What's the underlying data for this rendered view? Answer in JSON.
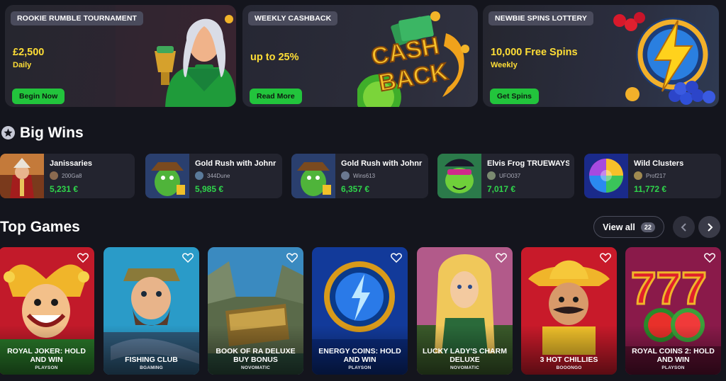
{
  "promos": [
    {
      "tag": "ROOKIE RUMBLE TOURNAMENT",
      "amount": "£2,500",
      "sub": "Daily",
      "button": "Begin Now"
    },
    {
      "tag": "WEEKLY CASHBACK",
      "amount": "up to 25%",
      "sub": "",
      "button": "Read More",
      "art_text_1": "CASH",
      "art_text_2": "BACK"
    },
    {
      "tag": "NEWBIE SPINS LOTTERY",
      "amount": "10,000 Free Spins",
      "sub": "Weekly",
      "button": "Get Spins"
    }
  ],
  "big_wins": {
    "title": "Big Wins",
    "items": [
      {
        "game": "Janissaries",
        "user": "200Ga8",
        "amount": "5,231 €"
      },
      {
        "game": "Gold Rush with Johnr",
        "user": "344Dune",
        "amount": "5,985 €"
      },
      {
        "game": "Gold Rush with Johnr",
        "user": "Wins613",
        "amount": "6,357 €"
      },
      {
        "game": "Elvis Frog TRUEWAYS",
        "user": "UFO037",
        "amount": "7,017 €"
      },
      {
        "game": "Wild Clusters",
        "user": "Prof217",
        "amount": "11,772 €"
      }
    ]
  },
  "top_games": {
    "title": "Top Games",
    "view_all_label": "View all",
    "view_all_count": "22",
    "games": [
      {
        "title": "ROYAL JOKER: HOLD AND WIN",
        "provider": "PLAYSON"
      },
      {
        "title": "FISHING CLUB",
        "provider": "BGAMING"
      },
      {
        "title": "BOOK OF RA DELUXE BUY BONUS",
        "provider": "NOVOMATIC"
      },
      {
        "title": "ENERGY COINS: HOLD AND WIN",
        "provider": "PLAYSON"
      },
      {
        "title": "LUCKY LADY'S CHARM DELUXE",
        "provider": "NOVOMATIC"
      },
      {
        "title": "3 HOT CHILLIES",
        "provider": "BOOONGO"
      },
      {
        "title": "ROYAL COINS 2: HOLD AND WIN",
        "provider": "PLAYSON"
      }
    ]
  },
  "icons": {
    "star": "star-icon",
    "heart": "heart-outline-icon",
    "prev": "chevron-left-icon",
    "next": "chevron-right-icon"
  },
  "colors": {
    "background": "#14151d",
    "accent_green": "#22c43c",
    "promo_yellow": "#ffde36",
    "win_green": "#2fd54b"
  }
}
